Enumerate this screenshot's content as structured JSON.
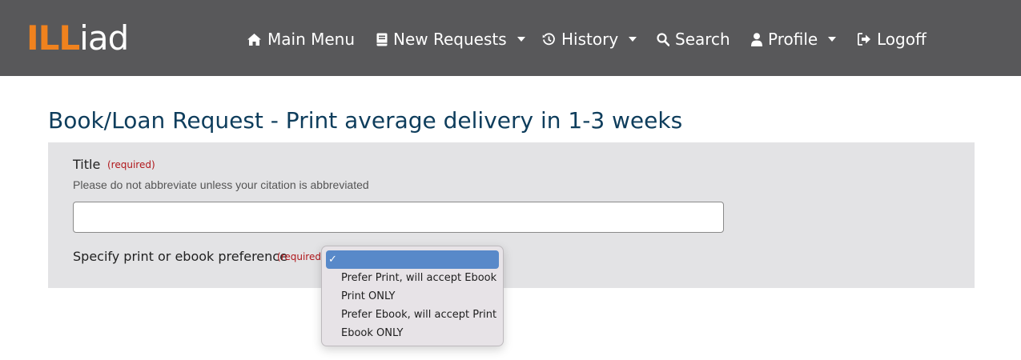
{
  "logo": {
    "part1": "ILL",
    "part2": "iad"
  },
  "nav": {
    "main_menu": "Main Menu",
    "new_requests": "New Requests",
    "history": "History",
    "search": "Search",
    "profile": "Profile",
    "logoff": "Logoff"
  },
  "page": {
    "title": "Book/Loan Request - Print average delivery in 1-3 weeks"
  },
  "form": {
    "title_label": "Title",
    "title_required": "(required)",
    "title_help": "Please do not abbreviate unless your citation is abbreviated",
    "title_value": "",
    "pref_label": "Specify print or ebook preference",
    "pref_required": "(required)",
    "pref_options": [
      {
        "label": "",
        "selected": true,
        "check": "✓"
      },
      {
        "label": "Prefer Print, will accept Ebook"
      },
      {
        "label": "Print ONLY"
      },
      {
        "label": "Prefer Ebook, will accept Print"
      },
      {
        "label": "Ebook ONLY"
      }
    ]
  },
  "colors": {
    "navbar_bg": "#58585a",
    "logo_accent": "#f0821e",
    "title_color": "#0e3d5c",
    "required_color": "#b0171b",
    "panel_bg": "#e3e3e5",
    "selected_option_bg": "#5889c9"
  },
  "icons": {
    "main_menu": "home-icon",
    "new_requests": "book-icon",
    "history": "history-icon",
    "search": "search-icon",
    "profile": "user-icon",
    "logoff": "sign-out-icon"
  }
}
